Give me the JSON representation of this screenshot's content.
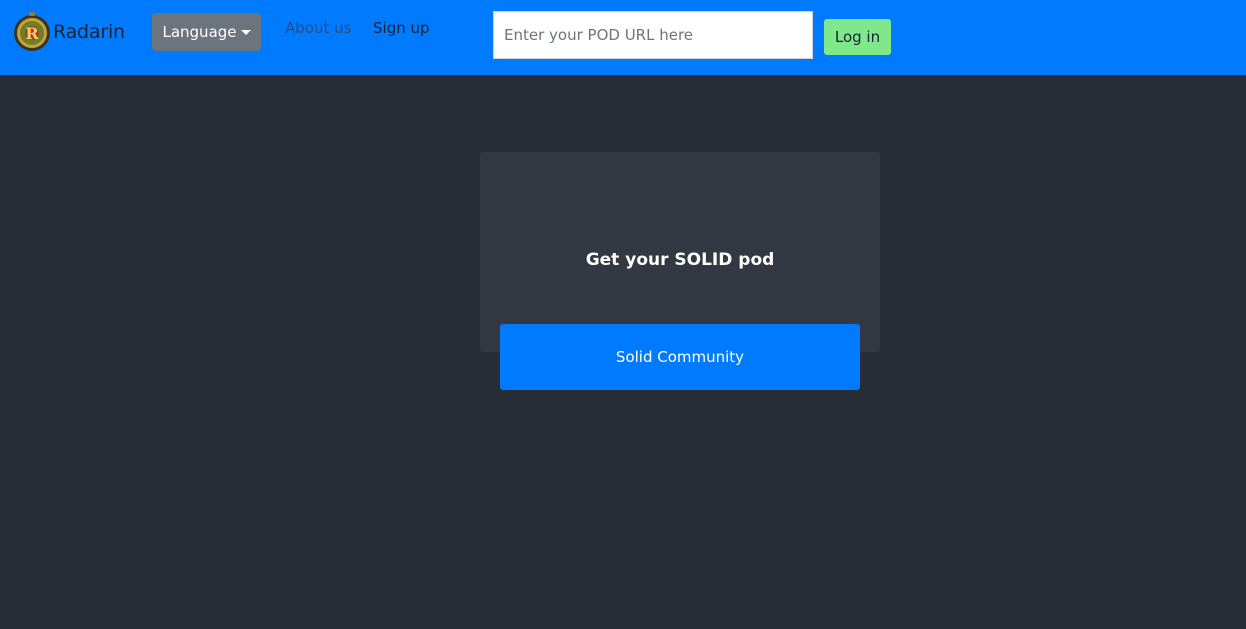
{
  "navbar": {
    "brand": "Radarin",
    "logo_icon": "radarin-logo-icon",
    "language_label": "Language",
    "links": [
      "About us",
      "Sign up"
    ],
    "pod_input": {
      "value": "",
      "placeholder": "Enter your POD URL here"
    },
    "login_label": "Log in"
  },
  "main": {
    "card_title": "Get your SOLID pod",
    "provider_button": "Solid Community"
  },
  "colors": {
    "navbar_bg": "#007bff",
    "page_bg": "#282c34",
    "card_bg": "#343842",
    "language_button": "#6c757d",
    "login_button": "#7ee88a",
    "provider_button": "#007bff"
  }
}
